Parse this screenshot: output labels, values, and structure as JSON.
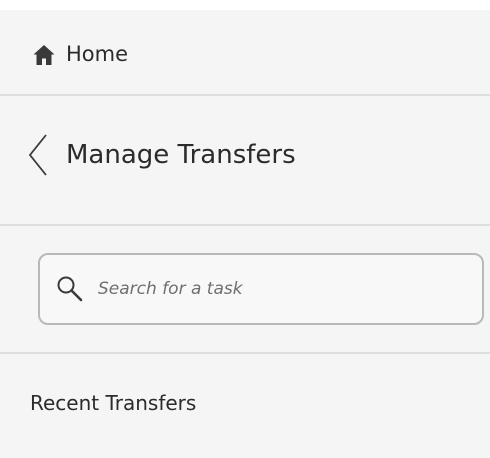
{
  "nav": {
    "home_label": "Home",
    "home_icon": "home-icon"
  },
  "header": {
    "title": "Manage Transfers",
    "back_icon": "chevron-left-icon"
  },
  "search": {
    "placeholder": "Search for a task",
    "value": "",
    "icon": "search-icon"
  },
  "sections": {
    "recent_label": "Recent Transfers"
  },
  "colors": {
    "panel_background": "#f5f5f5",
    "divider": "#dedede",
    "text": "#2b2b2b",
    "search_border": "#b9b9b9"
  }
}
